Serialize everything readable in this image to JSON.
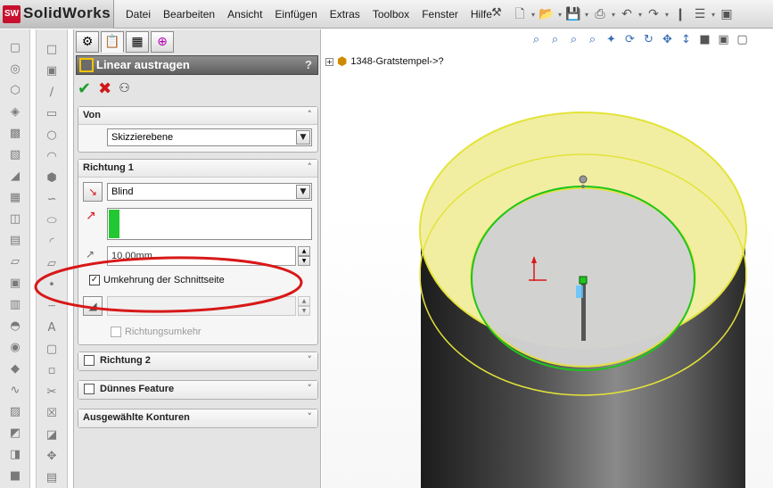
{
  "app": {
    "logo_badge": "SW",
    "logo_name": "SolidWorks",
    "menu": [
      "Datei",
      "Bearbeiten",
      "Ansicht",
      "Einfügen",
      "Extras",
      "Toolbox",
      "Fenster",
      "Hilfe"
    ]
  },
  "feature_manager": {
    "part_name": "1348-Gratstempel->?",
    "expander": "+"
  },
  "property_manager": {
    "title": "Linear austragen",
    "help": "?",
    "groups": {
      "von": {
        "title": "Von",
        "start_condition": "Skizzierebene"
      },
      "richtung1": {
        "title": "Richtung 1",
        "end_condition": "Blind",
        "depth": "10.00mm",
        "flip_side_to_cut_label": "Umkehrung der Schnittseite",
        "flip_side_to_cut_checked": true,
        "draft_direction_label": "Richtungsumkehr",
        "draft_direction_checked": false
      },
      "richtung2": {
        "title": "Richtung 2",
        "checked": false
      },
      "duennes_feature": {
        "title": "Dünnes Feature",
        "checked": false
      },
      "ausgewaehlte_konturen": {
        "title": "Ausgewählte Konturen"
      }
    }
  },
  "colors": {
    "accent_green": "#22c832",
    "sketch_green": "#1fc41f",
    "edge_yellow": "#e3e33a",
    "highlight_fill": "#f3f0a0",
    "annotation_red": "#d81818",
    "cylinder_dark": "#2a2a2a"
  }
}
